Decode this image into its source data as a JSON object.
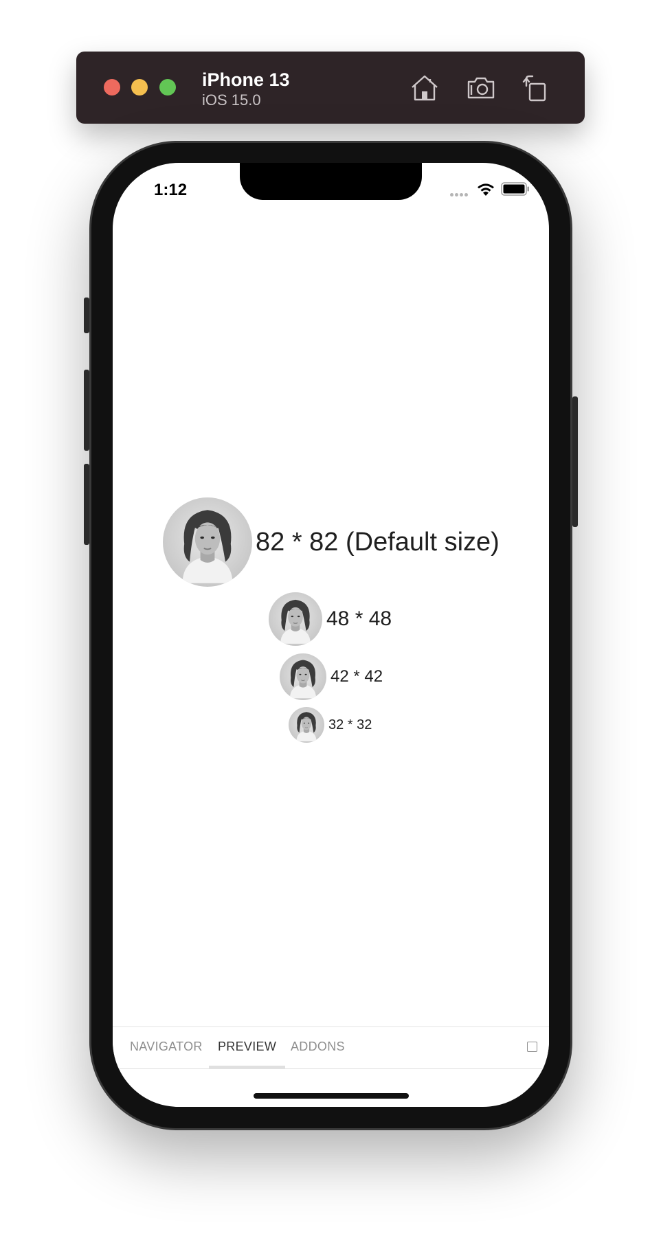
{
  "simulator": {
    "device_name": "iPhone 13",
    "os_version": "iOS 15.0",
    "icons": [
      "home-icon",
      "screenshot-icon",
      "rotate-icon"
    ]
  },
  "status_bar": {
    "time": "1:12",
    "icons": [
      "signal-dots-icon",
      "wifi-icon",
      "battery-icon"
    ]
  },
  "avatars": [
    {
      "label": "82 * 82 (Default size)"
    },
    {
      "label": "48 * 48"
    },
    {
      "label": "42 * 42"
    },
    {
      "label": "32 * 32"
    }
  ],
  "addons_panel": {
    "tabs": [
      "NAVIGATOR",
      "PREVIEW",
      "ADDONS"
    ],
    "active_tab": "PREVIEW"
  },
  "colors": {
    "title_bar": "#2e2427",
    "close": "#ed6a5e",
    "minimize": "#f5bf4f",
    "maximize": "#62c655"
  }
}
